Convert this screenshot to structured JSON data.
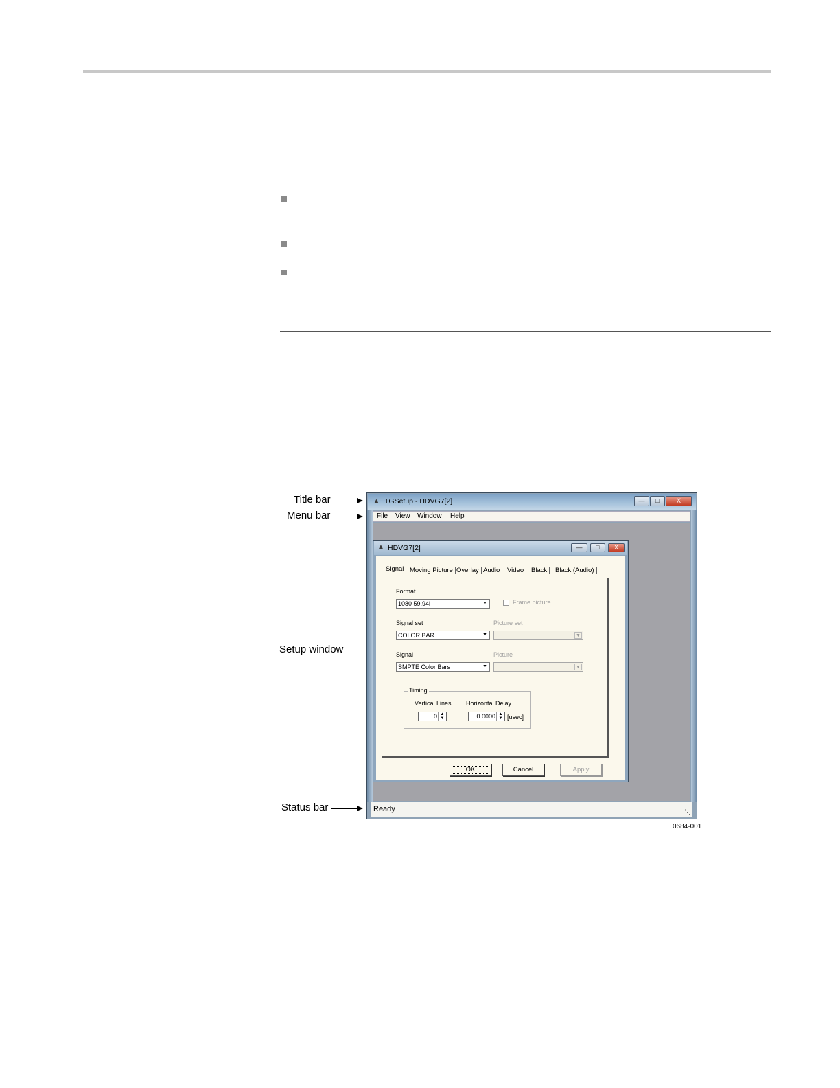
{
  "figure": {
    "callouts": {
      "title_bar": "Title bar",
      "menu_bar": "Menu bar",
      "setup_window": "Setup window",
      "status_bar": "Status bar"
    },
    "code": "0684-001"
  },
  "app": {
    "title": "TGSetup - HDVG7[2]",
    "menu": [
      "File",
      "View",
      "Window",
      "Help"
    ],
    "status": "Ready",
    "buttons": {
      "minimize": "—",
      "maximize": "□",
      "close": "X"
    }
  },
  "setup": {
    "title": "HDVG7[2]",
    "tabs": [
      "Signal",
      "Moving Picture",
      "Overlay",
      "Audio",
      "Video",
      "Black",
      "Black (Audio)"
    ],
    "active_tab": "Signal",
    "format_label": "Format",
    "format_value": "1080 59.94i",
    "frame_picture_label": "Frame picture",
    "signal_set_label": "Signal set",
    "signal_set_value": "COLOR BAR",
    "picture_set_label": "Picture set",
    "signal_label": "Signal",
    "signal_value": "SMPTE Color Bars",
    "picture_label": "Picture",
    "timing_label": "Timing",
    "vertical_lines_label": "Vertical Lines",
    "vertical_lines_value": "0",
    "horizontal_delay_label": "Horizontal Delay",
    "horizontal_delay_value": "0.0000",
    "horizontal_delay_unit": "[usec]",
    "ok": "OK",
    "cancel": "Cancel",
    "apply": "Apply"
  }
}
